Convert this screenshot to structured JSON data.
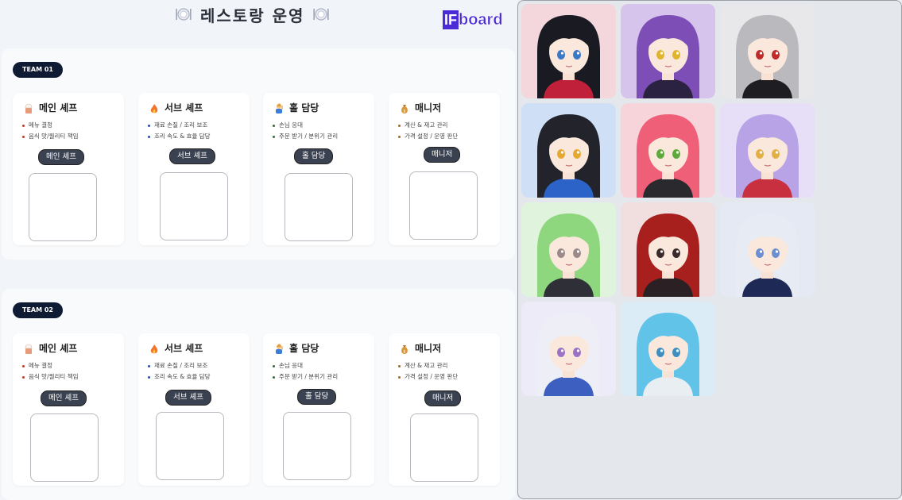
{
  "header": {
    "title": "레스토랑 운영",
    "brand_if": "IF",
    "brand_board": "board"
  },
  "teams": [
    {
      "label": "TEAM 01",
      "cards": [
        {
          "name": "메인 셰프",
          "items": [
            "메뉴 결정",
            "음식 맛/퀄리티 책임"
          ],
          "button": "메인 셰프"
        },
        {
          "name": "서브 셰프",
          "items": [
            "재료 손질 / 조리 보조",
            "조리 속도 & 효율 담당"
          ],
          "button": "서브 셰프"
        },
        {
          "name": "홀 담당",
          "items": [
            "손님 응대",
            "주문 받기 / 분위기 관리"
          ],
          "button": "홀 담당"
        },
        {
          "name": "매니저",
          "items": [
            "계산 & 재고 관리",
            "가격 설정 / 운영 판단"
          ],
          "button": "매니저"
        }
      ]
    },
    {
      "label": "TEAM 02",
      "cards": [
        {
          "name": "메인 셰프",
          "items": [
            "메뉴 결정",
            "음식 맛/퀄리티 책임"
          ],
          "button": "메인 셰프"
        },
        {
          "name": "서브 셰프",
          "items": [
            "재료 손질 / 조리 보조",
            "조리 속도 & 효율 담당"
          ],
          "button": "서브 셰프"
        },
        {
          "name": "홀 담당",
          "items": [
            "손님 응대",
            "주문 받기 / 분위기 관리"
          ],
          "button": "홀 담당"
        },
        {
          "name": "매니저",
          "items": [
            "계산 & 재고 관리",
            "가격 설정 / 운영 판단"
          ],
          "button": "매니저"
        }
      ]
    }
  ],
  "role_icons": [
    "chef-icon",
    "fire-icon",
    "waving-person-icon",
    "money-bag-icon"
  ],
  "bullet_colors": [
    "#c0392b",
    "#2e4ea3",
    "#2e6b3f",
    "#a46a1f"
  ],
  "avatars": [
    {
      "name": "avatar-black-hair-red-bow",
      "bg": "#f3d7dc",
      "hair": "#1a1a22",
      "accent": "#c0203a",
      "eye": "#3a78c8"
    },
    {
      "name": "avatar-purple-hair-horns",
      "bg": "#d7c4ec",
      "hair": "#7d4fb6",
      "accent": "#2a2240",
      "eye": "#e1b430"
    },
    {
      "name": "avatar-silver-hair-police-cap",
      "bg": "#e8e8ea",
      "hair": "#b9b9be",
      "accent": "#1d1d22",
      "eye": "#c02a2a"
    },
    {
      "name": "avatar-blue-hood",
      "bg": "#cfe0f6",
      "hair": "#23232b",
      "accent": "#2b63c9",
      "eye": "#e6a930"
    },
    {
      "name": "avatar-pink-hair-sunglasses",
      "bg": "#f7d4da",
      "hair": "#f05f78",
      "accent": "#2a2a2e",
      "eye": "#5caa3c"
    },
    {
      "name": "avatar-lavender-hair-cat-ears",
      "bg": "#e7dff7",
      "hair": "#b8a3e6",
      "accent": "#c83040",
      "eye": "#e2b045"
    },
    {
      "name": "avatar-green-hair",
      "bg": "#dff3dd",
      "hair": "#8fd77f",
      "accent": "#2f2f37",
      "eye": "#9a8a8a"
    },
    {
      "name": "avatar-red-hair",
      "bg": "#f1dede",
      "hair": "#a8201e",
      "accent": "#2b2024",
      "eye": "#3a2a2a"
    },
    {
      "name": "avatar-white-hair-maid",
      "bg": "#e4e9f4",
      "hair": "#e6ebf4",
      "accent": "#1e2a55",
      "eye": "#6c8fd2"
    },
    {
      "name": "avatar-white-hair-unicorn",
      "bg": "#eeebf8",
      "hair": "#eeeef6",
      "accent": "#3c5fc0",
      "eye": "#9c72c7"
    },
    {
      "name": "avatar-aqua-hair-goggles",
      "bg": "#dcecf7",
      "hair": "#62c3e8",
      "accent": "#e9eef3",
      "eye": "#3d8fc2"
    }
  ]
}
